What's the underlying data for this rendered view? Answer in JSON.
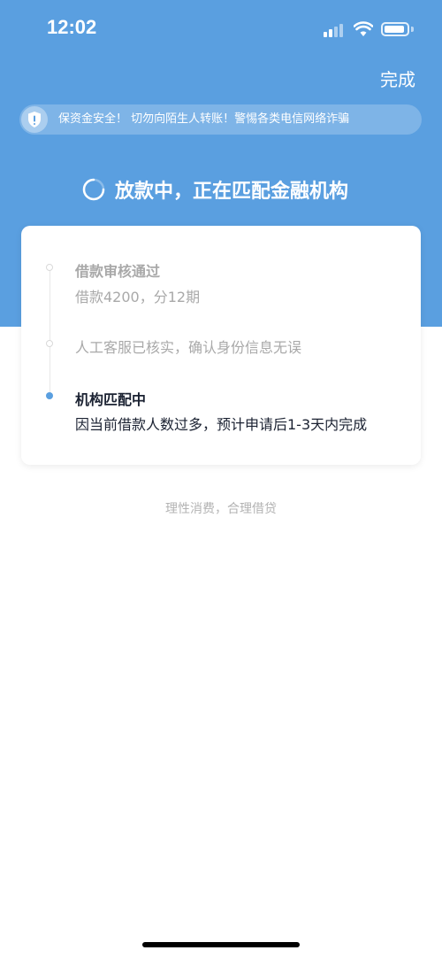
{
  "status_bar": {
    "time": "12:02"
  },
  "header": {
    "done_label": "完成"
  },
  "notice": {
    "icon": "shield-exclamation-icon",
    "text": "保资金安全！          切勿向陌生人转账！警惕各类电信网络诈骗"
  },
  "status": {
    "title": "放款中，正在匹配金融机构"
  },
  "timeline": {
    "steps": [
      {
        "title": "借款审核通过",
        "subtitle": "借款4200，分12期",
        "state": "done"
      },
      {
        "title": "人工客服已核实，确认身份信息无误",
        "state": "done"
      },
      {
        "title": "机构匹配中",
        "subtitle": "因当前借款人数过多，预计申请后1-3天内完成",
        "state": "active"
      }
    ]
  },
  "footer": {
    "note": "理性消费，合理借贷"
  },
  "colors": {
    "primary": "#5a9fe0",
    "text_dark": "#1b2232",
    "text_muted": "#a9a9a9"
  }
}
